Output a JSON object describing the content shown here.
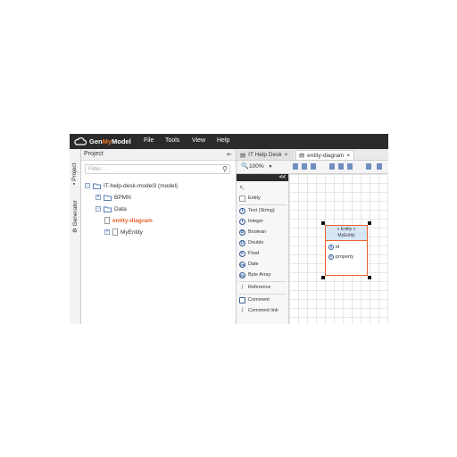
{
  "topbar": {
    "logo": {
      "prefix": "Gen",
      "highlight": "My",
      "suffix": "Model"
    },
    "menu": [
      "File",
      "Tools",
      "View",
      "Help"
    ]
  },
  "side_tabs": [
    "Project",
    "Generator"
  ],
  "project_panel": {
    "title": "Project",
    "filter_placeholder": "Filter...",
    "tree": [
      {
        "label": "IT-help-desk-model3 (model)",
        "toggle": "⊟"
      },
      {
        "label": "BPMN",
        "toggle": "⊞"
      },
      {
        "label": "Data",
        "toggle": "⊟"
      },
      {
        "label": "entity-diagram",
        "active": true
      },
      {
        "label": "MyEntity",
        "toggle": "⊞"
      }
    ]
  },
  "editor": {
    "tabs": [
      {
        "label": "IT Help Desk",
        "close": "×"
      },
      {
        "label": "entity-diagram",
        "close": "×"
      }
    ],
    "zoom": "100%",
    "zoom_caret": "▼"
  },
  "palette": {
    "collapse": "<<",
    "items": [
      {
        "label": "Entity",
        "icon": "E"
      },
      {
        "label": "Text (String)",
        "icon": "T"
      },
      {
        "label": "Integer",
        "icon": "I"
      },
      {
        "label": "Boolean",
        "icon": "B"
      },
      {
        "label": "Double",
        "icon": "D"
      },
      {
        "label": "Float",
        "icon": "F"
      },
      {
        "label": "Date",
        "icon": "Da"
      },
      {
        "label": "Byte Array",
        "icon": "By"
      },
      {
        "label": "Reference",
        "icon": "/"
      },
      {
        "label": "Comment",
        "icon": "C"
      },
      {
        "label": "Comment link",
        "icon": "/"
      }
    ]
  },
  "diagram": {
    "entity": {
      "stereotype": "« Entity »",
      "name": "MyEntity",
      "attributes": [
        {
          "name": "id",
          "icon": "I"
        },
        {
          "name": "property",
          "icon": "I"
        }
      ]
    }
  },
  "colors": {
    "accent": "#e8602c",
    "topbar": "#2b2b2b",
    "entity_head": "#d7e6f5"
  }
}
